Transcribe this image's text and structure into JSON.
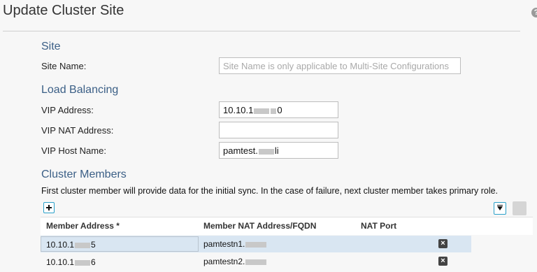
{
  "dialog": {
    "title": "Update Cluster Site"
  },
  "site": {
    "heading": "Site",
    "name_label": "Site Name:",
    "name_placeholder": "Site Name is only applicable to Multi-Site Configurations"
  },
  "load_balancing": {
    "heading": "Load Balancing",
    "vip_address_label": "VIP Address:",
    "vip_address_prefix": "10.10.1",
    "vip_address_suffix": "0",
    "vip_nat_label": "VIP NAT Address:",
    "vip_nat_value": "",
    "vip_host_label": "VIP Host Name:",
    "vip_host_prefix": "pamtest.",
    "vip_host_suffix": "li"
  },
  "cluster_members": {
    "heading": "Cluster Members",
    "info": "First cluster member will provide data for the initial sync. In the case of failure, next cluster member takes primary role.",
    "columns": [
      "Member Address *",
      "Member NAT Address/FQDN",
      "NAT Port"
    ],
    "rows": [
      {
        "addr_prefix": "10.10.1",
        "addr_suffix": "5",
        "nat_prefix": "pamtestn1.",
        "nat_port": ""
      },
      {
        "addr_prefix": "10.10.1",
        "addr_suffix": "6",
        "nat_prefix": "pamtestn2.",
        "nat_port": ""
      }
    ]
  },
  "icons": {
    "help": "help-icon",
    "add": "add-icon",
    "filter": "filter-icon",
    "delete": "delete-icon"
  }
}
